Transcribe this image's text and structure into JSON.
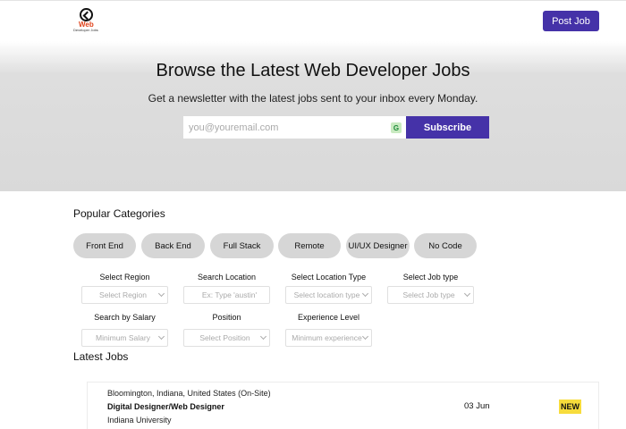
{
  "header": {
    "logo_text": "Web",
    "logo_subtext": "Developer Jobs",
    "post_job_label": "Post Job"
  },
  "hero": {
    "title": "Browse the Latest Web Developer Jobs",
    "subtitle": "Get a newsletter with the latest jobs sent to your inbox every Monday.",
    "email_placeholder": "you@youremail.com",
    "subscribe_label": "Subscribe"
  },
  "categories": {
    "title": "Popular Categories",
    "items": [
      "Front End",
      "Back End",
      "Full Stack",
      "Remote",
      "UI/UX Designer",
      "No Code"
    ]
  },
  "filters": {
    "region": {
      "label": "Select Region",
      "value": "Select Region"
    },
    "location": {
      "label": "Search Location",
      "placeholder": "Ex: Type 'austin'"
    },
    "location_type": {
      "label": "Select Location Type",
      "value": "Select location type"
    },
    "job_type": {
      "label": "Select Job type",
      "value": "Select Job type"
    },
    "salary": {
      "label": "Search by  Salary",
      "value": "Minimum Salary"
    },
    "position": {
      "label": "Position",
      "value": "Select Position"
    },
    "experience": {
      "label": "Experience Level",
      "value": "Minimum experience"
    }
  },
  "latest": {
    "title": "Latest Jobs",
    "jobs": [
      {
        "location": "Bloomington, Indiana, United States (On-Site)",
        "title": "Digital Designer/Web Designer",
        "company": "Indiana University",
        "date": "03 Jun",
        "badge": "NEW"
      }
    ]
  },
  "colors": {
    "accent": "#4532a8",
    "badge": "#f7dc3c",
    "chip": "#d6d6d6",
    "hero_bg": "#d9d9d9"
  }
}
